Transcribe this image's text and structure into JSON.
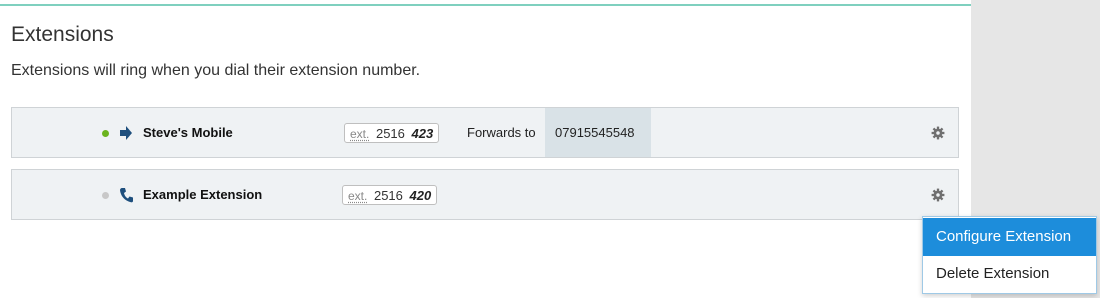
{
  "page": {
    "title": "Extensions",
    "subtitle": "Extensions will ring when you dial their extension number."
  },
  "extensions": [
    {
      "status": "online",
      "type_icon": "forward-arrow-icon",
      "name": "Steve's Mobile",
      "ext_abbr": "ext.",
      "ext_prefix": "2516",
      "ext_suffix": "423",
      "forward_label": "Forwards to",
      "forward_number": "07915545548"
    },
    {
      "status": "offline",
      "type_icon": "phone-icon",
      "name": "Example Extension",
      "ext_abbr": "ext.",
      "ext_prefix": "2516",
      "ext_suffix": "420"
    }
  ],
  "context_menu": {
    "items": [
      "Configure Extension",
      "Delete Extension"
    ],
    "highlighted_index": 0
  },
  "colors": {
    "accent_bar": "#7fd0bf",
    "status_online": "#6bb41e",
    "status_offline": "#c8c8c8",
    "menu_highlight": "#1d8ddb",
    "icon_blue": "#1e4f7d"
  }
}
